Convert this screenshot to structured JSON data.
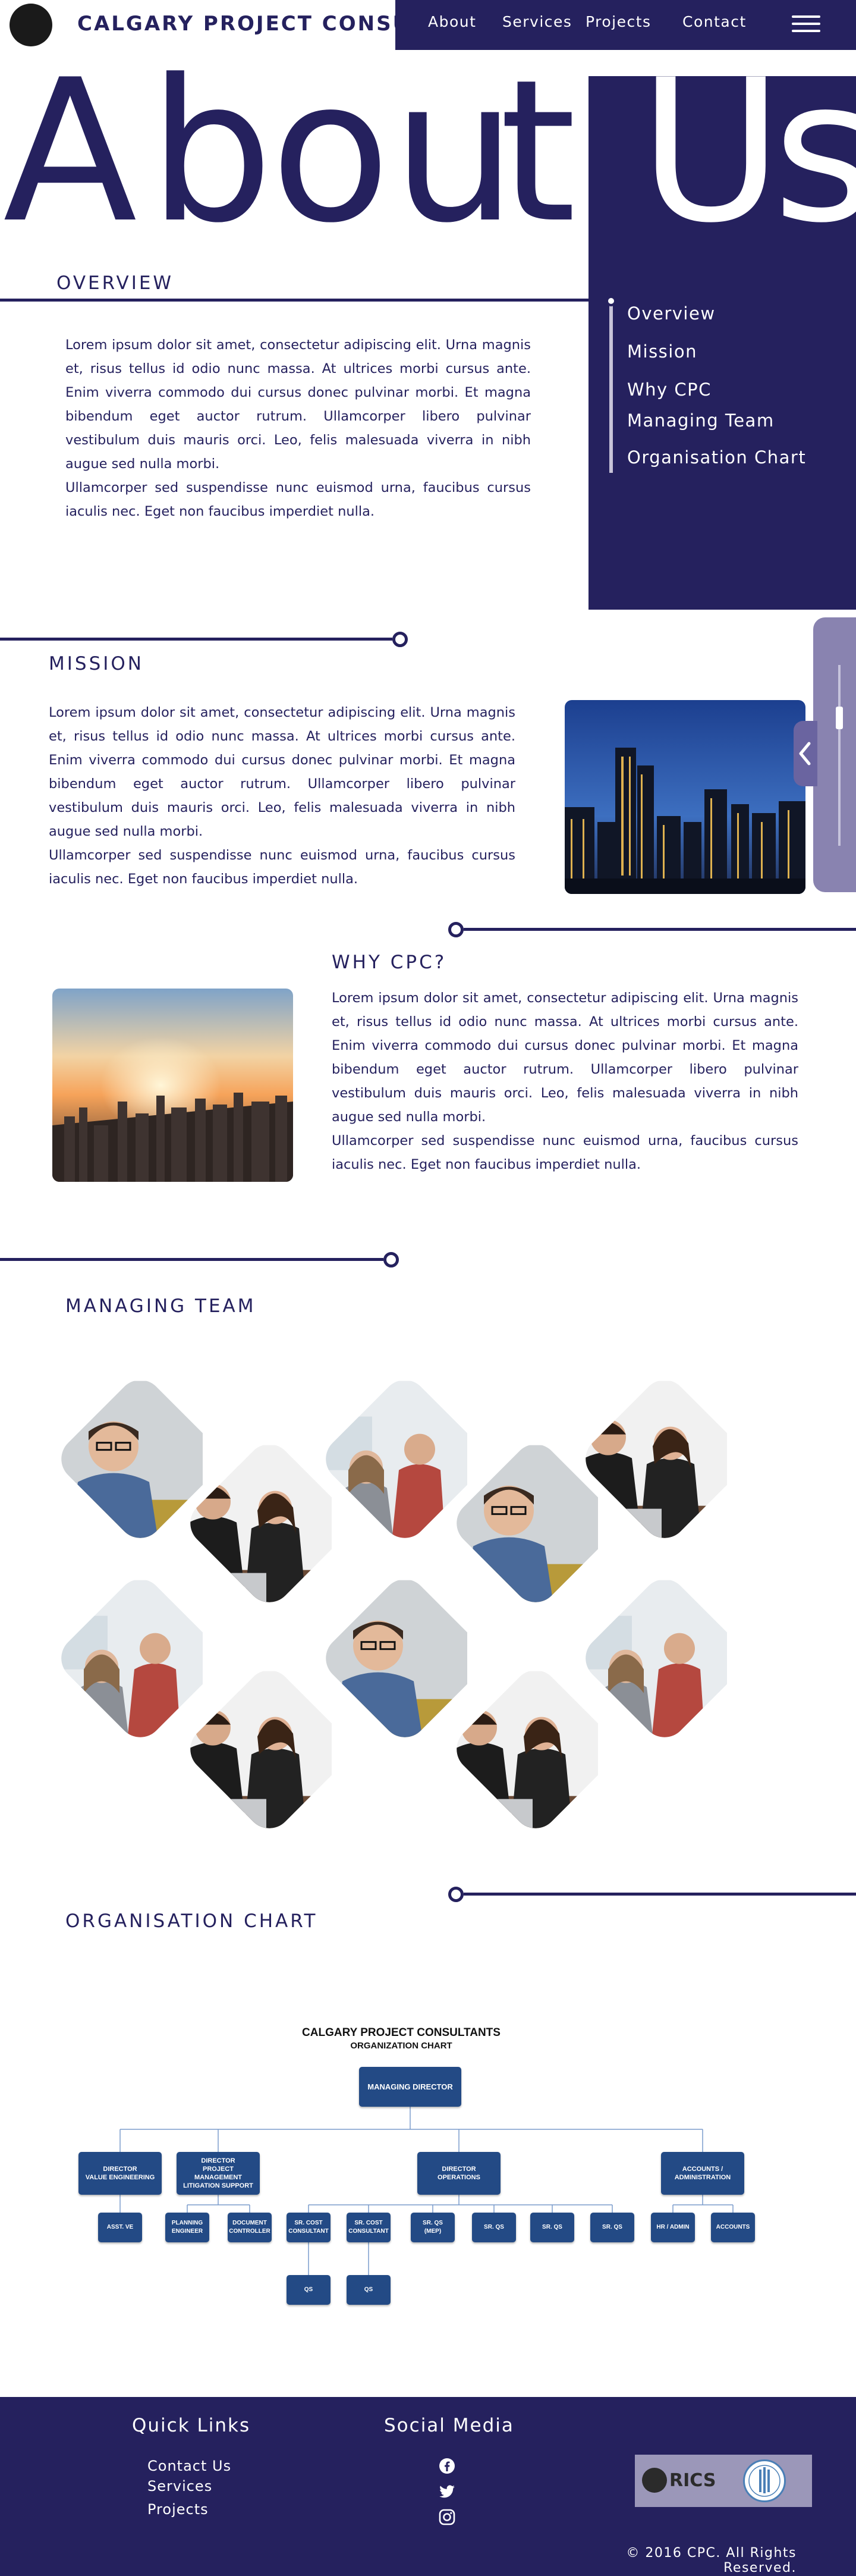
{
  "header": {
    "brand": "CALGARY PROJECT CONSULTANTS",
    "nav": [
      "About",
      "Services",
      "Projects",
      "Contact"
    ],
    "menu_icon": "hamburger-menu-icon"
  },
  "hero": {
    "title": "About Us"
  },
  "overview": {
    "title": "OVERVIEW",
    "text1": "Lorem ipsum dolor sit amet, consectetur adipiscing elit. Urna magnis et, risus tellus id odio nunc massa. At ultrices morbi cursus ante. Enim viverra commodo dui cursus donec pulvinar morbi. Et magna bibendum eget auctor rutrum. Ullamcorper libero pulvinar vestibulum duis mauris orci. Leo, felis malesuada viverra in nibh augue sed nulla morbi.",
    "text2": "Ullamcorper sed suspendisse nunc euismod urna, faucibus cursus iaculis nec. Eget non faucibus imperdiet nulla."
  },
  "toc": [
    "Overview",
    "Mission",
    "Why CPC",
    "Managing Team",
    "Organisation Chart"
  ],
  "mission": {
    "title": "MISSION",
    "text1": "Lorem ipsum dolor sit amet, consectetur adipiscing elit. Urna magnis et, risus tellus id odio nunc massa. At ultrices morbi cursus ante. Enim viverra commodo dui cursus donec pulvinar morbi. Et magna bibendum eget auctor rutrum. Ullamcorper libero pulvinar vestibulum duis mauris orci. Leo, felis malesuada viverra in nibh augue sed nulla morbi.",
    "text2": "Ullamcorper sed suspendisse nunc euismod urna, faucibus cursus iaculis nec. Eget non faucibus imperdiet nulla."
  },
  "why": {
    "title": "WHY CPC?",
    "text1": "Lorem ipsum dolor sit amet, consectetur adipiscing elit. Urna magnis et, risus tellus id odio nunc massa. At ultrices morbi cursus ante. Enim viverra commodo dui cursus donec pulvinar morbi. Et magna bibendum eget auctor rutrum. Ullamcorper libero pulvinar vestibulum duis mauris orci. Leo, felis malesuada viverra in nibh augue sed nulla morbi.",
    "text2": "Ullamcorper sed suspendisse nunc euismod urna, faucibus cursus iaculis nec. Eget non faucibus imperdiet nulla."
  },
  "team": {
    "title": "MANAGING TEAM"
  },
  "org": {
    "title": "ORGANISATION CHART",
    "chart_title": "CALGARY PROJECT CONSULTANTS",
    "chart_subtitle": "ORGANIZATION CHART",
    "top": "MANAGING DIRECTOR",
    "directors": [
      "DIRECTOR\nVALUE ENGINEERING",
      "DIRECTOR\nPROJECT MANAGEMENT\nLITIGATION SUPPORT",
      "DIRECTOR\nOPERATIONS",
      "ACCOUNTS /\nADMINISTRATION"
    ],
    "staff": [
      "ASST. VE",
      "PLANNING\nENGINEER",
      "DOCUMENT\nCONTROLLER",
      "SR. COST\nCONSULTANT",
      "SR. COST\nCONSULTANT",
      "SR. QS\n(MEP)",
      "SR. QS",
      "SR. QS",
      "SR. QS",
      "HR / ADMIN",
      "ACCOUNTS"
    ],
    "juniors": [
      "QS",
      "QS"
    ]
  },
  "footer": {
    "quick_links_title": "Quick Links",
    "links": [
      "Contact Us",
      "Services",
      "Projects"
    ],
    "social_title": "Social Media",
    "social_icons": [
      "facebook-icon",
      "twitter-icon",
      "instagram-icon"
    ],
    "rics_label": "RICS",
    "copyright": "© 2016 CPC. All Rights Reserved."
  },
  "colors": {
    "primary": "#25215e",
    "widget": "#8983b0",
    "org_box": "#234a85"
  }
}
